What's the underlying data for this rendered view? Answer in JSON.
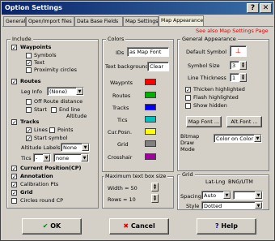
{
  "window": {
    "title": "Option Settings",
    "help_btn": "?",
    "close_btn": "✕"
  },
  "tabs": [
    {
      "label": "General"
    },
    {
      "label": "Open/Import files"
    },
    {
      "label": "Data Base Fields"
    },
    {
      "label": "Map Settings"
    },
    {
      "label": "Map Appearance"
    }
  ],
  "note": "See also Map Settings Page",
  "include": {
    "title": "Include",
    "waypoints": "Waypoints",
    "symbols": "Symbols",
    "text": "Text",
    "proximity": "Proximity circles",
    "routes": "Routes",
    "leg_info": "Leg Info",
    "leg_info_value": "(None)",
    "off_route": "Off Route distance",
    "start": "Start",
    "end_line": "End line",
    "altitude": "Altitude",
    "tracks": "Tracks",
    "lines": "Lines",
    "points": "Points",
    "start_symbol": "Start symbol",
    "alt_labels": "Altitude Labels",
    "alt_labels_value": "None",
    "tics": "Tics",
    "tics_value1": "-",
    "tics_value2": "none",
    "current_position": "Current Position(CP)",
    "annotation": "Annotation",
    "calibration": "Calibration Pts",
    "grid": "Grid",
    "circles_cp": "Circles round CP"
  },
  "colors": {
    "title": "Colors",
    "ids_label": "IDs",
    "ids_value": "as Map Font",
    "text_bg_label": "Text background",
    "text_bg_value": "Clear",
    "items": [
      {
        "label": "Waypnts",
        "color": "#ff0000"
      },
      {
        "label": "Routes",
        "color": "#00b000"
      },
      {
        "label": "Tracks",
        "color": "#0000ff"
      },
      {
        "label": "Tics",
        "color": "#00c0c0"
      },
      {
        "label": "Cur.Posn.",
        "color": "#ffff00"
      },
      {
        "label": "Grid",
        "color": "#808080"
      },
      {
        "label": "Crosshair",
        "color": "#a000a0"
      }
    ]
  },
  "textbox": {
    "title": "Maximum text box size",
    "width_label": "Width = 50",
    "rows_label": "Rows  = 10"
  },
  "appearance": {
    "title": "General Appearance",
    "default_symbol": "Default Symbol",
    "symbol_size": "Symbol Size",
    "symbol_size_value": "3",
    "line_thickness": "Line Thickness",
    "line_thickness_value": "1",
    "thicken": "Thicken highlighted",
    "flash": "Flash highlighted",
    "show_hidden": "Show hidden",
    "map_font_btn": "Map Font ...",
    "alt_font_btn": "Alt.Font ...",
    "bitmap_label": "Bitmap Draw Mode",
    "bitmap_value": "Color on Color"
  },
  "gridbox": {
    "title": "Grid",
    "latlng": "Lat-Lng",
    "bng": "BNG/UTM",
    "spacing_label": "Spacing",
    "spacing_value": "Auto",
    "style_label": "Style",
    "style_value": "Dotted",
    "grid_font_btn": "Grid Font ..."
  },
  "buttons": {
    "ok": "OK",
    "cancel": "Cancel",
    "help": "Help"
  }
}
